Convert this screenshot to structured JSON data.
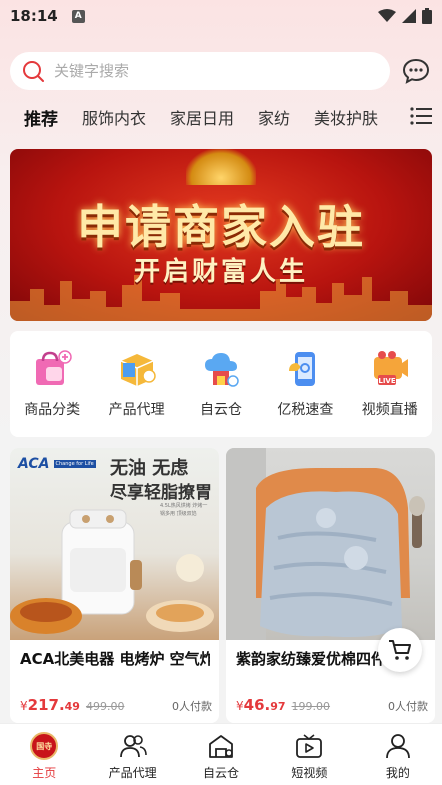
{
  "status_bar": {
    "time": "18:14",
    "notification": "A"
  },
  "search": {
    "placeholder": "关键字搜索"
  },
  "tabs": [
    "推荐",
    "服饰内衣",
    "家居日用",
    "家纺",
    "美妆护肤"
  ],
  "banner": {
    "title": "申请商家入驻",
    "subtitle": "开启财富人生"
  },
  "categories": [
    {
      "label": "商品分类",
      "icon": "shopping-bag-icon"
    },
    {
      "label": "产品代理",
      "icon": "box-agent-icon"
    },
    {
      "label": "自云仓",
      "icon": "cloud-warehouse-icon"
    },
    {
      "label": "亿税速查",
      "icon": "tax-lookup-icon"
    },
    {
      "label": "视频直播",
      "icon": "live-video-icon"
    }
  ],
  "products": [
    {
      "title": "ACA北美电器 电烤炉 空气炸锅",
      "price_symbol": "¥",
      "price_int": "217.",
      "price_dec": "49",
      "price_old": "499.00",
      "paid": "0人付款",
      "image_text": {
        "brand": "ACA",
        "tagline": "Change for Life",
        "headline1": "无油 无虑",
        "headline2": "尽享轻脂撩胃",
        "side_note": "4.5L热风烘烤 炸烤一锅多用 顶级双馅"
      }
    },
    {
      "title": "紫韵家纺臻爱优棉四件套",
      "price_symbol": "¥",
      "price_int": "46.",
      "price_dec": "97",
      "price_old": "199.00",
      "paid": "0人付款"
    }
  ],
  "bottom_nav": [
    {
      "label": "主页",
      "icon": "home-logo-icon",
      "logo_text": "国寺",
      "active": true
    },
    {
      "label": "产品代理",
      "icon": "users-icon"
    },
    {
      "label": "自云仓",
      "icon": "warehouse-icon"
    },
    {
      "label": "短视频",
      "icon": "tv-play-icon"
    },
    {
      "label": "我的",
      "icon": "user-icon"
    }
  ],
  "colors": {
    "accent": "#e4393c",
    "banner_red": "#b8140f",
    "gold": "#ffe9a8"
  }
}
